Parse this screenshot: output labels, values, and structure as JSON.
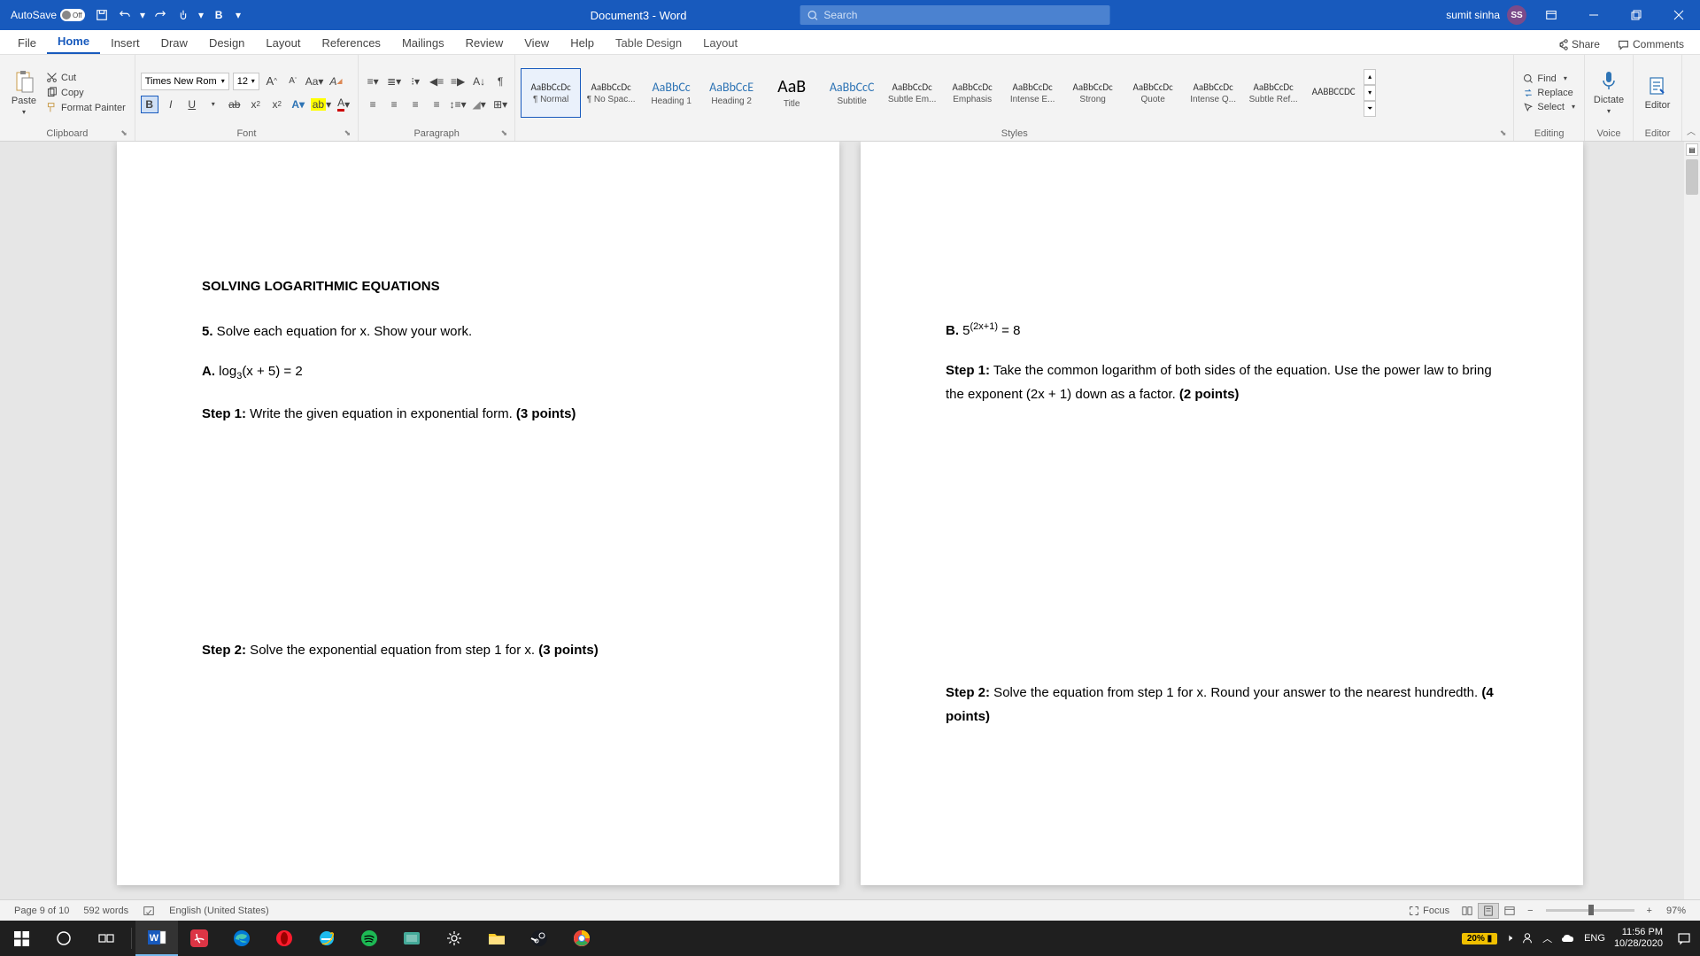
{
  "titlebar": {
    "autosave_label": "AutoSave",
    "autosave_state": "Off",
    "doc_title": "Document3  -  Word",
    "search_placeholder": "Search",
    "user_name": "sumit sinha",
    "user_initials": "SS"
  },
  "tabs": {
    "items": [
      "File",
      "Home",
      "Insert",
      "Draw",
      "Design",
      "Layout",
      "References",
      "Mailings",
      "Review",
      "View",
      "Help",
      "Table Design",
      "Layout"
    ],
    "active_index": 1,
    "share": "Share",
    "comments": "Comments"
  },
  "ribbon": {
    "clipboard": {
      "paste": "Paste",
      "cut": "Cut",
      "copy": "Copy",
      "format_painter": "Format Painter",
      "label": "Clipboard"
    },
    "font": {
      "name": "Times New Rom",
      "size": "12",
      "label": "Font"
    },
    "paragraph": {
      "label": "Paragraph"
    },
    "styles": {
      "label": "Styles",
      "items": [
        {
          "preview": "AaBbCcDc",
          "name": "¶ Normal",
          "cls": ""
        },
        {
          "preview": "AaBbCcDc",
          "name": "¶ No Spac...",
          "cls": ""
        },
        {
          "preview": "AaBbCc",
          "name": "Heading 1",
          "cls": "heading"
        },
        {
          "preview": "AaBbCcE",
          "name": "Heading 2",
          "cls": "heading"
        },
        {
          "preview": "AaB",
          "name": "Title",
          "cls": "title"
        },
        {
          "preview": "AaBbCcC",
          "name": "Subtitle",
          "cls": "heading"
        },
        {
          "preview": "AaBbCcDc",
          "name": "Subtle Em...",
          "cls": ""
        },
        {
          "preview": "AaBbCcDc",
          "name": "Emphasis",
          "cls": ""
        },
        {
          "preview": "AaBbCcDc",
          "name": "Intense E...",
          "cls": ""
        },
        {
          "preview": "AaBbCcDc",
          "name": "Strong",
          "cls": ""
        },
        {
          "preview": "AaBbCcDc",
          "name": "Quote",
          "cls": ""
        },
        {
          "preview": "AaBbCcDc",
          "name": "Intense Q...",
          "cls": ""
        },
        {
          "preview": "AaBbCcDc",
          "name": "Subtle Ref...",
          "cls": ""
        },
        {
          "preview": "AABBCCDC",
          "name": "",
          "cls": ""
        }
      ]
    },
    "editing": {
      "find": "Find",
      "replace": "Replace",
      "select": "Select",
      "label": "Editing"
    },
    "voice": {
      "dictate": "Dictate",
      "label": "Voice"
    },
    "editor": {
      "editor": "Editor",
      "label": "Editor"
    }
  },
  "document": {
    "heading": "SOLVING LOGARITHMIC EQUATIONS",
    "q5": "5.",
    "q5_text": " Solve each equation for x. Show your work.",
    "a_label": "A.",
    "a_eq_pre": " log",
    "a_eq_sub": "3",
    "a_eq_post": "(x + 5) = 2",
    "step1": "Step 1:",
    "step1_text": " Write the given equation in exponential form. ",
    "step1_pts": "(3 points)",
    "step2a": "Step 2:",
    "step2a_text": " Solve the exponential equation from step 1 for x. ",
    "step2a_pts": "(3 points)",
    "b_label": "B.",
    "b_eq_pre": " 5",
    "b_eq_sup": "(2x+1)",
    "b_eq_post": " = 8",
    "step1b": "Step 1:",
    "step1b_text": " Take the common logarithm of both sides of the equation. Use the power law to bring the exponent (2x + 1) down as a factor. ",
    "step1b_pts": "(2 points)",
    "step2b": "Step 2:",
    "step2b_text": " Solve the equation from step 1 for x. Round your answer to the nearest hundredth. ",
    "step2b_pts": "(4 points)"
  },
  "statusbar": {
    "page": "Page 9 of 10",
    "words": "592 words",
    "language": "English (United States)",
    "focus": "Focus",
    "zoom": "97%"
  },
  "taskbar": {
    "battery": "20%",
    "lang": "ENG",
    "time": "11:56 PM",
    "date": "10/28/2020"
  }
}
